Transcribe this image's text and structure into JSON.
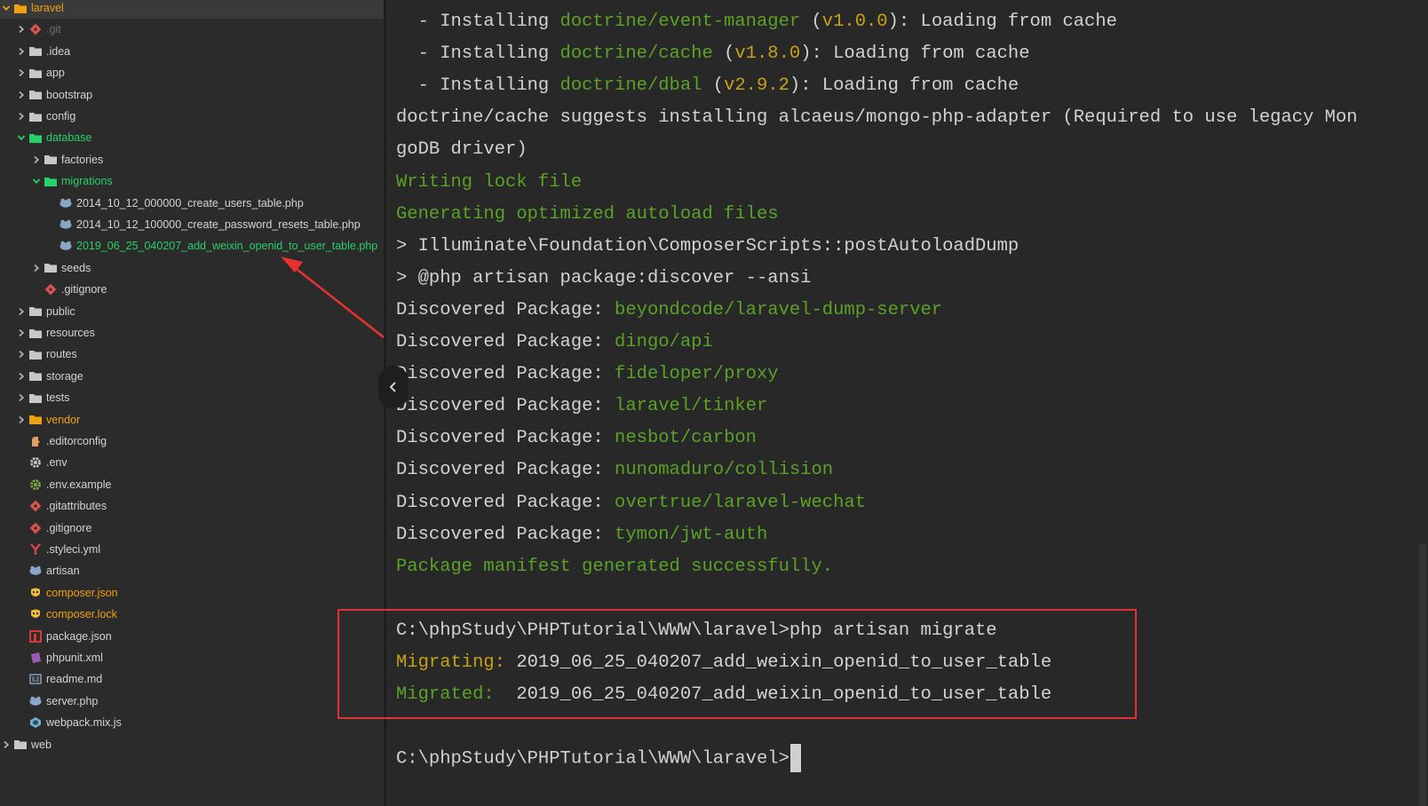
{
  "sidebar": {
    "items": [
      {
        "label": "laravel",
        "depth": 0,
        "chev": "open",
        "icon": "folder",
        "color": "orange",
        "root": true
      },
      {
        "label": ".git",
        "depth": 1,
        "chev": "closed",
        "icon": "git",
        "color": "dim"
      },
      {
        "label": ".idea",
        "depth": 1,
        "chev": "closed",
        "icon": "folder"
      },
      {
        "label": "app",
        "depth": 1,
        "chev": "closed",
        "icon": "folder"
      },
      {
        "label": "bootstrap",
        "depth": 1,
        "chev": "closed",
        "icon": "folder"
      },
      {
        "label": "config",
        "depth": 1,
        "chev": "closed",
        "icon": "folder"
      },
      {
        "label": "database",
        "depth": 1,
        "chev": "open",
        "icon": "folder",
        "color": "green"
      },
      {
        "label": "factories",
        "depth": 2,
        "chev": "closed",
        "icon": "folder"
      },
      {
        "label": "migrations",
        "depth": 2,
        "chev": "open",
        "icon": "folder",
        "color": "green"
      },
      {
        "label": "2014_10_12_000000_create_users_table.php",
        "depth": 3,
        "chev": "none",
        "icon": "php"
      },
      {
        "label": "2014_10_12_100000_create_password_resets_table.php",
        "depth": 3,
        "chev": "none",
        "icon": "php"
      },
      {
        "label": "2019_06_25_040207_add_weixin_openid_to_user_table.php",
        "depth": 3,
        "chev": "none",
        "icon": "php",
        "color": "green"
      },
      {
        "label": "seeds",
        "depth": 2,
        "chev": "closed",
        "icon": "folder"
      },
      {
        "label": ".gitignore",
        "depth": 2,
        "chev": "none",
        "icon": "git"
      },
      {
        "label": "public",
        "depth": 1,
        "chev": "closed",
        "icon": "folder"
      },
      {
        "label": "resources",
        "depth": 1,
        "chev": "closed",
        "icon": "folder"
      },
      {
        "label": "routes",
        "depth": 1,
        "chev": "closed",
        "icon": "folder"
      },
      {
        "label": "storage",
        "depth": 1,
        "chev": "closed",
        "icon": "folder"
      },
      {
        "label": "tests",
        "depth": 1,
        "chev": "closed",
        "icon": "folder"
      },
      {
        "label": "vendor",
        "depth": 1,
        "chev": "closed",
        "icon": "folder",
        "color": "orange"
      },
      {
        "label": ".editorconfig",
        "depth": 1,
        "chev": "none",
        "icon": "editorconfig"
      },
      {
        "label": ".env",
        "depth": 1,
        "chev": "none",
        "icon": "gear"
      },
      {
        "label": ".env.example",
        "depth": 1,
        "chev": "none",
        "icon": "gear-green"
      },
      {
        "label": ".gitattributes",
        "depth": 1,
        "chev": "none",
        "icon": "git"
      },
      {
        "label": ".gitignore",
        "depth": 1,
        "chev": "none",
        "icon": "git"
      },
      {
        "label": ".styleci.yml",
        "depth": 1,
        "chev": "none",
        "icon": "styleci"
      },
      {
        "label": "artisan",
        "depth": 1,
        "chev": "none",
        "icon": "php"
      },
      {
        "label": "composer.json",
        "depth": 1,
        "chev": "none",
        "icon": "composer",
        "color": "orange"
      },
      {
        "label": "composer.lock",
        "depth": 1,
        "chev": "none",
        "icon": "composer",
        "color": "orange"
      },
      {
        "label": "package.json",
        "depth": 1,
        "chev": "none",
        "icon": "npm"
      },
      {
        "label": "phpunit.xml",
        "depth": 1,
        "chev": "none",
        "icon": "phpunit"
      },
      {
        "label": "readme.md",
        "depth": 1,
        "chev": "none",
        "icon": "readme"
      },
      {
        "label": "server.php",
        "depth": 1,
        "chev": "none",
        "icon": "php"
      },
      {
        "label": "webpack.mix.js",
        "depth": 1,
        "chev": "none",
        "icon": "webpack"
      },
      {
        "label": "web",
        "depth": 0,
        "chev": "closed",
        "icon": "folder"
      }
    ]
  },
  "terminal": {
    "lines": [
      [
        {
          "t": "  - Installing ",
          "c": "white"
        },
        {
          "t": "doctrine/event-manager",
          "c": "green"
        },
        {
          "t": " (",
          "c": "white"
        },
        {
          "t": "v1.0.0",
          "c": "yellow"
        },
        {
          "t": "): Loading from cache",
          "c": "white"
        }
      ],
      [
        {
          "t": "  - Installing ",
          "c": "white"
        },
        {
          "t": "doctrine/cache",
          "c": "green"
        },
        {
          "t": " (",
          "c": "white"
        },
        {
          "t": "v1.8.0",
          "c": "yellow"
        },
        {
          "t": "): Loading from cache",
          "c": "white"
        }
      ],
      [
        {
          "t": "  - Installing ",
          "c": "white"
        },
        {
          "t": "doctrine/dbal",
          "c": "green"
        },
        {
          "t": " (",
          "c": "white"
        },
        {
          "t": "v2.9.2",
          "c": "yellow"
        },
        {
          "t": "): Loading from cache",
          "c": "white"
        }
      ],
      [
        {
          "t": "doctrine/cache suggests installing alcaeus/mongo-php-adapter (Required to use legacy Mon",
          "c": "white"
        }
      ],
      [
        {
          "t": "goDB driver)",
          "c": "white"
        }
      ],
      [
        {
          "t": "Writing lock file",
          "c": "green"
        }
      ],
      [
        {
          "t": "Generating optimized autoload files",
          "c": "green"
        }
      ],
      [
        {
          "t": "> Illuminate\\Foundation\\ComposerScripts::postAutoloadDump",
          "c": "white"
        }
      ],
      [
        {
          "t": "> @php artisan package:discover --ansi",
          "c": "white"
        }
      ],
      [
        {
          "t": "Discovered Package: ",
          "c": "white"
        },
        {
          "t": "beyondcode/laravel-dump-server",
          "c": "green"
        }
      ],
      [
        {
          "t": "Discovered Package: ",
          "c": "white"
        },
        {
          "t": "dingo/api",
          "c": "green"
        }
      ],
      [
        {
          "t": "Discovered Package: ",
          "c": "white"
        },
        {
          "t": "fideloper/proxy",
          "c": "green"
        }
      ],
      [
        {
          "t": "Discovered Package: ",
          "c": "white"
        },
        {
          "t": "laravel/tinker",
          "c": "green"
        }
      ],
      [
        {
          "t": "Discovered Package: ",
          "c": "white"
        },
        {
          "t": "nesbot/carbon",
          "c": "green"
        }
      ],
      [
        {
          "t": "Discovered Package: ",
          "c": "white"
        },
        {
          "t": "nunomaduro/collision",
          "c": "green"
        }
      ],
      [
        {
          "t": "Discovered Package: ",
          "c": "white"
        },
        {
          "t": "overtrue/laravel-wechat",
          "c": "green"
        }
      ],
      [
        {
          "t": "Discovered Package: ",
          "c": "white"
        },
        {
          "t": "tymon/jwt-auth",
          "c": "green"
        }
      ],
      [
        {
          "t": "Package manifest generated successfully.",
          "c": "green"
        }
      ],
      [],
      [
        {
          "t": "C:\\phpStudy\\PHPTutorial\\WWW\\laravel>php artisan migrate",
          "c": "white"
        }
      ],
      [
        {
          "t": "Migrating:",
          "c": "yellow"
        },
        {
          "t": " 2019_06_25_040207_add_weixin_openid_to_user_table",
          "c": "white"
        }
      ],
      [
        {
          "t": "Migrated:",
          "c": "green"
        },
        {
          "t": "  2019_06_25_040207_add_weixin_openid_to_user_table",
          "c": "white"
        }
      ],
      [],
      [
        {
          "t": "C:\\phpStudy\\PHPTutorial\\WWW\\laravel>",
          "c": "white"
        }
      ]
    ]
  },
  "colors": {
    "sidebar_bg": "#2b2b2b",
    "terminal_bg": "#282828",
    "highlight": "#e0303a",
    "green_text": "#27d06a",
    "orange_text": "#f0a10f"
  }
}
